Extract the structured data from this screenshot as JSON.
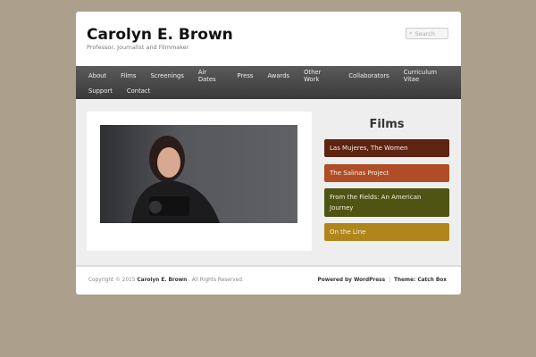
{
  "site": {
    "title": "Carolyn E. Brown",
    "tagline": "Professor, Journalist and Filmmaker"
  },
  "search": {
    "placeholder": "Search"
  },
  "nav": [
    "About",
    "Films",
    "Screenings",
    "Air Dates",
    "Press",
    "Awards",
    "Other Work",
    "Collaborators",
    "Curriculum Vitae",
    "Support",
    "Contact"
  ],
  "sidebar": {
    "heading": "Films",
    "films": [
      {
        "label": "Las Mujeres, The Women",
        "color": "#5e2412"
      },
      {
        "label": "The Salinas Project",
        "color": "#b04d26"
      },
      {
        "label": "From the Fields: An American Journey",
        "color": "#4f5412"
      },
      {
        "label": "On the Line",
        "color": "#b0861c"
      }
    ]
  },
  "footer": {
    "copyright_prefix": "Copyright © 2015",
    "owner": "Carolyn E. Brown",
    "suffix": ". All Rights Reserved.",
    "powered": "Powered by WordPress",
    "sep": "|",
    "theme": "Theme: Catch Box"
  }
}
